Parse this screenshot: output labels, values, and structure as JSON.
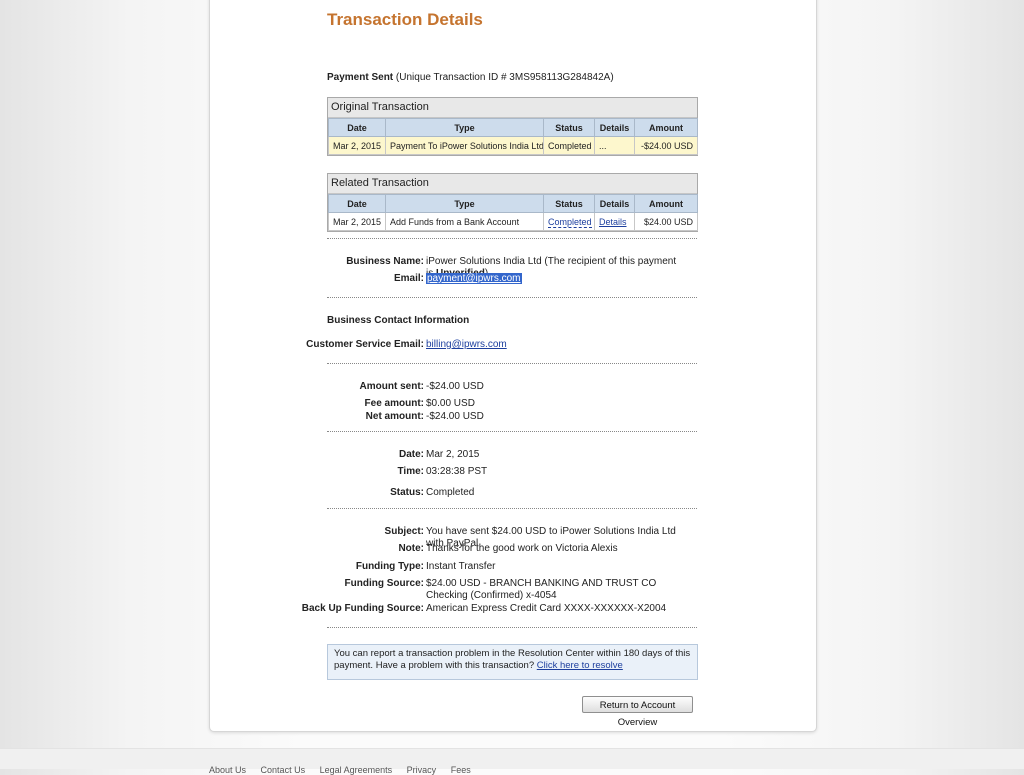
{
  "page": {
    "title": "Transaction Details",
    "payment_sent_label": "Payment Sent",
    "transaction_id_text": "(Unique Transaction ID # 3MS958113G284842A)"
  },
  "original_transaction": {
    "caption": "Original Transaction",
    "headers": [
      "Date",
      "Type",
      "Status",
      "Details",
      "Amount"
    ],
    "row": {
      "date": "Mar 2, 2015",
      "type": "Payment To iPower Solutions India Ltd",
      "status": "Completed",
      "details": "...",
      "amount": "-$24.00 USD"
    }
  },
  "related_transaction": {
    "caption": "Related Transaction",
    "headers": [
      "Date",
      "Type",
      "Status",
      "Details",
      "Amount"
    ],
    "row": {
      "date": "Mar 2, 2015",
      "type": "Add Funds from a Bank Account",
      "status": "Completed",
      "details": "Details",
      "amount": "$24.00 USD"
    }
  },
  "business": {
    "name_label": "Business Name:",
    "name_value": "iPower Solutions India Ltd (The recipient of this payment is ",
    "name_status": "Unverified",
    "name_close": ")",
    "email_label": "Email:",
    "email_value": "payment@ipwrs.com"
  },
  "contact": {
    "heading": "Business Contact Information",
    "cs_email_label": "Customer Service Email:",
    "cs_email_value": "billing@ipwrs.com"
  },
  "amounts": {
    "sent_label": "Amount sent:",
    "sent_value": "-$24.00 USD",
    "fee_label": "Fee amount:",
    "fee_value": "$0.00 USD",
    "net_label": "Net amount:",
    "net_value": "-$24.00 USD"
  },
  "timing": {
    "date_label": "Date:",
    "date_value": "Mar 2, 2015",
    "time_label": "Time:",
    "time_value": "03:28:38 PST",
    "status_label": "Status:",
    "status_value": "Completed"
  },
  "details": {
    "subject_label": "Subject:",
    "subject_value": "You have sent $24.00 USD to iPower Solutions India Ltd with PayPal",
    "note_label": "Note:",
    "note_value": "Thanks for the good work on Victoria Alexis",
    "funding_type_label": "Funding Type:",
    "funding_type_value": "Instant Transfer",
    "funding_source_label": "Funding Source:",
    "funding_source_value": "$24.00 USD - BRANCH BANKING AND TRUST CO Checking (Confirmed) x-4054",
    "backup_label": "Back Up Funding Source:",
    "backup_value": "American Express Credit Card XXXX-XXXXXX-X2004"
  },
  "notice": {
    "text": "You can report a transaction problem in the Resolution Center within 180 days of this payment. Have a problem with this transaction? ",
    "link": "Click here to resolve"
  },
  "actions": {
    "return_label": "Return to Account Overview"
  },
  "footer": {
    "links": [
      "About Us",
      "Contact Us",
      "Legal Agreements",
      "Privacy",
      "Fees"
    ]
  }
}
